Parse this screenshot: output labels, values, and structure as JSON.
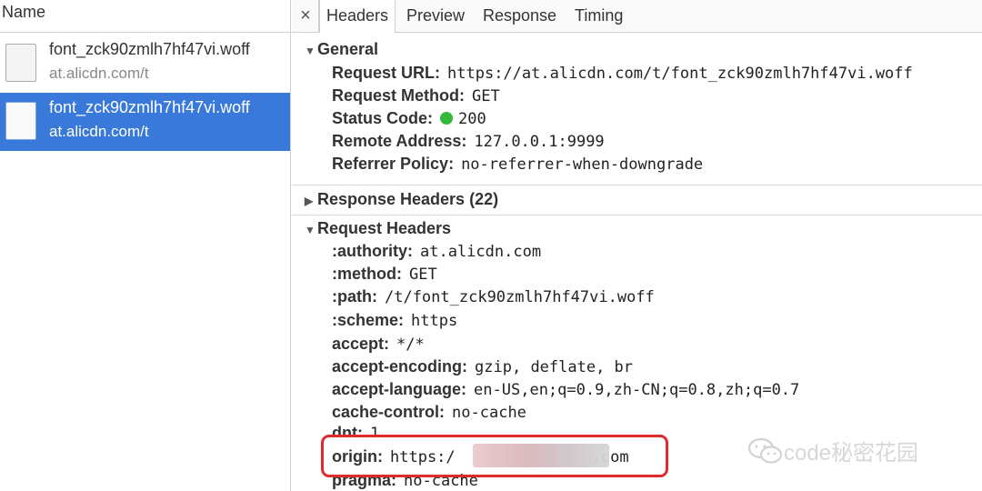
{
  "left_panel": {
    "header": "Name",
    "requests": [
      {
        "file": "font_zck90zmlh7hf47vi.woff",
        "host": "at.alicdn.com/t",
        "selected": false
      },
      {
        "file": "font_zck90zmlh7hf47vi.woff",
        "host": "at.alicdn.com/t",
        "selected": true
      }
    ]
  },
  "tabs": {
    "close": "×",
    "items": [
      "Headers",
      "Preview",
      "Response",
      "Timing"
    ],
    "active": "Headers"
  },
  "general": {
    "title": "General",
    "rows": [
      {
        "key": "Request URL:",
        "value": "https://at.alicdn.com/t/font_zck90zmlh7hf47vi.woff"
      },
      {
        "key": "Request Method:",
        "value": "GET"
      },
      {
        "key": "Status Code:",
        "value": "200"
      },
      {
        "key": "Remote Address:",
        "value": "127.0.0.1:9999"
      },
      {
        "key": "Referrer Policy:",
        "value": "no-referrer-when-downgrade"
      }
    ]
  },
  "response_headers": {
    "title": "Response Headers (22)"
  },
  "request_headers": {
    "title": "Request Headers",
    "rows": [
      {
        "key": ":authority:",
        "value": "at.alicdn.com"
      },
      {
        "key": ":method:",
        "value": "GET"
      },
      {
        "key": ":path:",
        "value": "/t/font_zck90zmlh7hf47vi.woff"
      },
      {
        "key": ":scheme:",
        "value": "https"
      },
      {
        "key": "accept:",
        "value": "*/*"
      },
      {
        "key": "accept-encoding:",
        "value": "gzip, deflate, br"
      },
      {
        "key": "accept-language:",
        "value": "en-US,en;q=0.9,zh-CN;q=0.8,zh;q=0.7"
      },
      {
        "key": "cache-control:",
        "value": "no-cache"
      },
      {
        "key": "dnt:",
        "value": "1"
      },
      {
        "key": "origin:",
        "value": "https:/",
        "value_suffix": ".com"
      },
      {
        "key": "pragma:",
        "value": "no-cache"
      }
    ]
  },
  "watermark": {
    "text": "code秘密花园"
  },
  "colors": {
    "selected_row": "#3879d9",
    "status_ok": "#35b93c",
    "highlight": "#e02b2b"
  }
}
